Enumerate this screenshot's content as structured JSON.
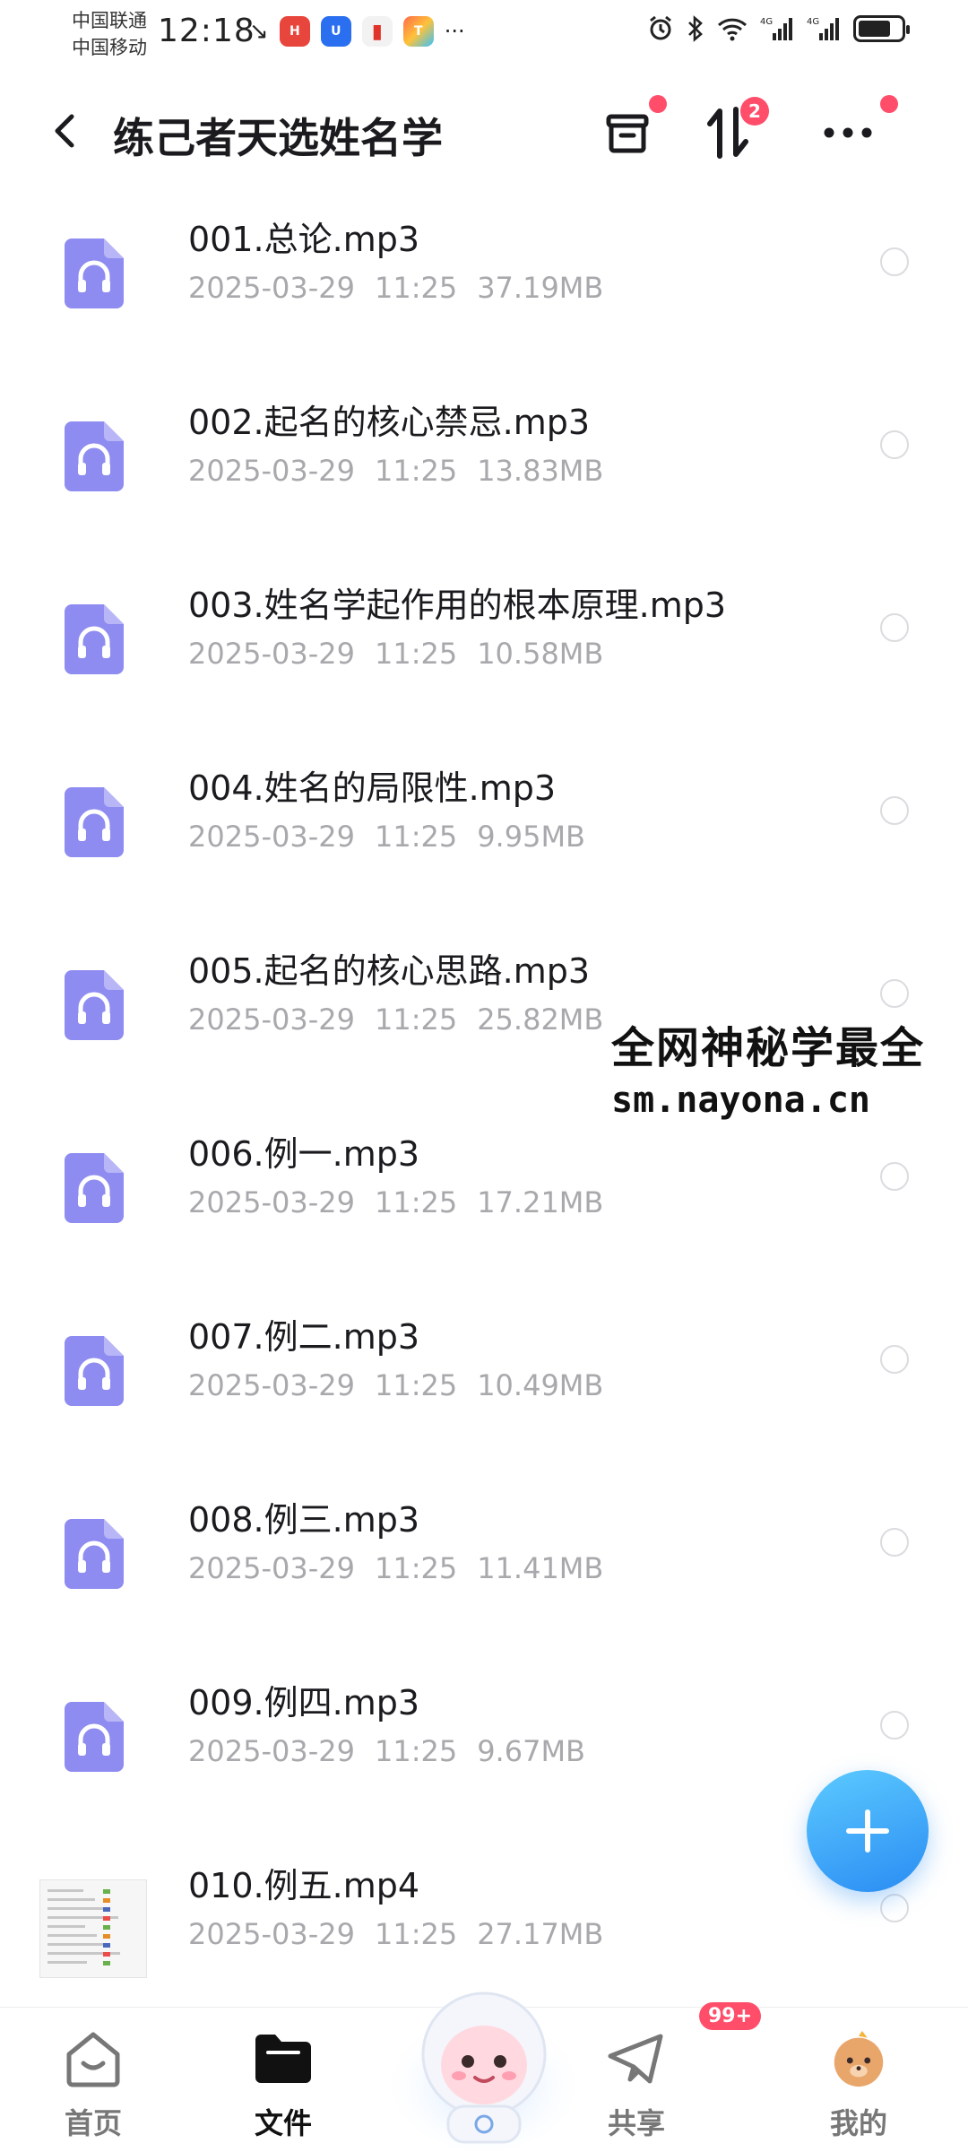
{
  "status_bar": {
    "carrier_1": "中国联通",
    "carrier_2": "中国移动",
    "time": "12:18",
    "more": "···",
    "icons_left": [
      "call-missed-icon",
      "huawei-app-icon",
      "blue-app-icon",
      "book-app-icon",
      "colorful-app-icon"
    ],
    "icons_right": [
      "alarm-icon",
      "bluetooth-icon",
      "wifi-icon",
      "signal-4g-icon",
      "signal-4g-icon",
      "battery-icon"
    ],
    "battery_level": 0.75
  },
  "header": {
    "title": "练己者天选姓名学",
    "transfer_badge": "2"
  },
  "files": [
    {
      "name": "001.总论.mp3",
      "date": "2025-03-29",
      "time": "11:25",
      "size": "37.19MB",
      "type": "audio"
    },
    {
      "name": "002.起名的核心禁忌.mp3",
      "date": "2025-03-29",
      "time": "11:25",
      "size": "13.83MB",
      "type": "audio"
    },
    {
      "name": "003.姓名学起作用的根本原理.mp3",
      "date": "2025-03-29",
      "time": "11:25",
      "size": "10.58MB",
      "type": "audio"
    },
    {
      "name": "004.姓名的局限性.mp3",
      "date": "2025-03-29",
      "time": "11:25",
      "size": "9.95MB",
      "type": "audio"
    },
    {
      "name": "005.起名的核心思路.mp3",
      "date": "2025-03-29",
      "time": "11:25",
      "size": "25.82MB",
      "type": "audio"
    },
    {
      "name": "006.例一.mp3",
      "date": "2025-03-29",
      "time": "11:25",
      "size": "17.21MB",
      "type": "audio"
    },
    {
      "name": "007.例二.mp3",
      "date": "2025-03-29",
      "time": "11:25",
      "size": "10.49MB",
      "type": "audio"
    },
    {
      "name": "008.例三.mp3",
      "date": "2025-03-29",
      "time": "11:25",
      "size": "11.41MB",
      "type": "audio"
    },
    {
      "name": "009.例四.mp3",
      "date": "2025-03-29",
      "time": "11:25",
      "size": "9.67MB",
      "type": "audio"
    },
    {
      "name": "010.例五.mp4",
      "date": "2025-03-29",
      "time": "11:25",
      "size": "27.17MB",
      "type": "video"
    }
  ],
  "watermark": {
    "line1": "全网神秘学最全",
    "line2": "sm.nayona.cn"
  },
  "bottom_nav": {
    "home": "首页",
    "files": "文件",
    "share": "共享",
    "me": "我的",
    "share_badge": "99+"
  },
  "colors": {
    "accent": "#2a8cf3",
    "audio_icon": "#8e8cf0",
    "badge": "#ff4d6a",
    "meta_text": "#a9a9ad"
  }
}
